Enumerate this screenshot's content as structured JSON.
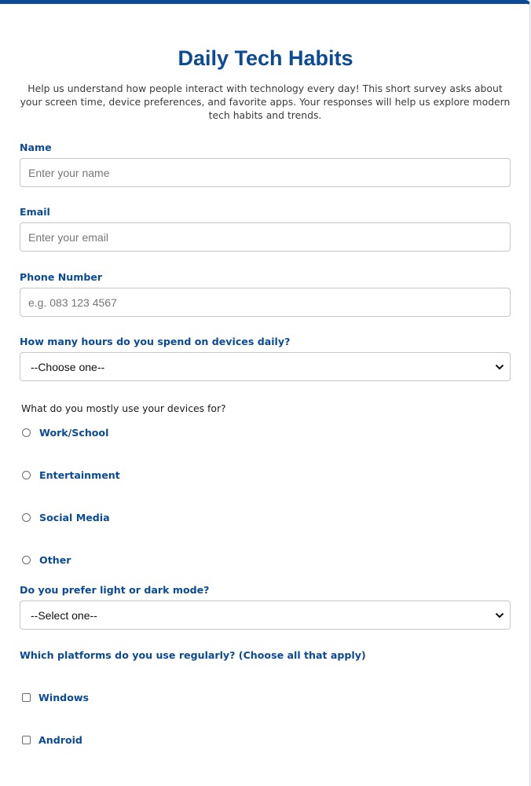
{
  "header": {
    "title": "Daily Tech Habits",
    "intro": "Help us understand how people interact with technology every day! This short survey asks about your screen time, device preferences, and favorite apps. Your responses will help us explore modern tech habits and trends."
  },
  "fields": {
    "name": {
      "label": "Name",
      "placeholder": "Enter your name",
      "value": ""
    },
    "email": {
      "label": "Email",
      "placeholder": "Enter your email",
      "value": ""
    },
    "phone": {
      "label": "Phone Number",
      "placeholder": "e.g. 083 123 4567",
      "value": ""
    }
  },
  "hours": {
    "label": "How many hours do you spend on devices daily?",
    "selected": "--Choose one--"
  },
  "usage": {
    "question": "What do you mostly use your devices for?",
    "options": [
      "Work/School",
      "Entertainment",
      "Social Media",
      "Other"
    ]
  },
  "mode": {
    "label": "Do you prefer light or dark mode?",
    "selected": "--Select one--"
  },
  "platforms": {
    "label": "Which platforms do you use regularly? (Choose all that apply)",
    "options": [
      "Windows",
      "Android"
    ]
  },
  "colors": {
    "accent": "#0a4a96"
  },
  "icons": {
    "select_arrow": "chevron-down-icon"
  }
}
